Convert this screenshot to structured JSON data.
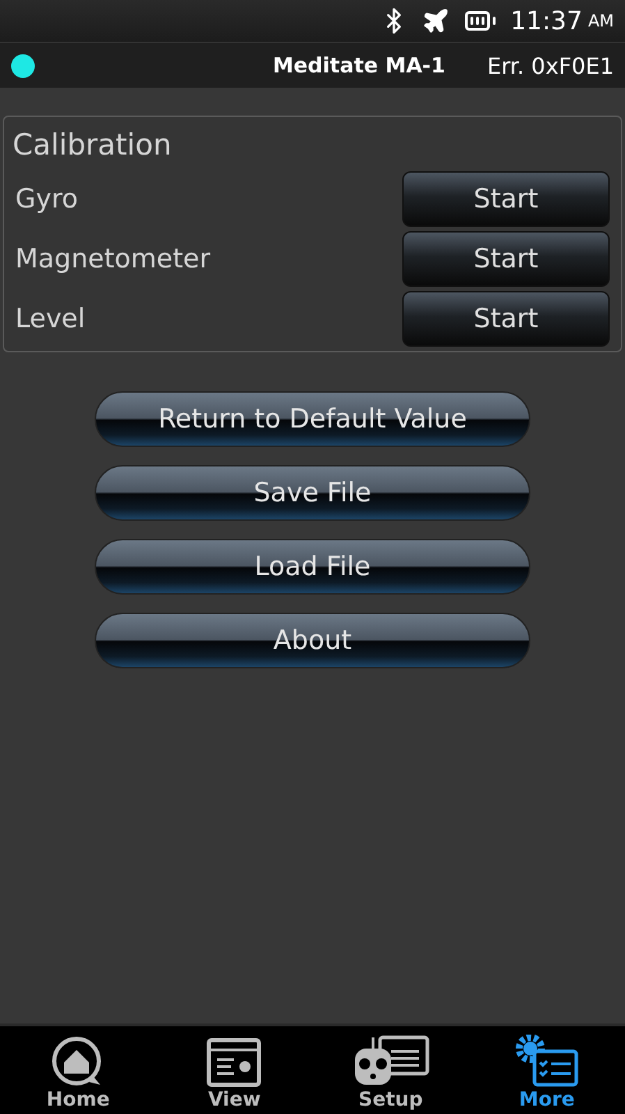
{
  "status_bar": {
    "time": "11:37",
    "ampm": "AM"
  },
  "header": {
    "status_dot": {
      "color": "#1ee8e4"
    },
    "title": "Meditate MA-1",
    "error": "Err. 0xF0E1"
  },
  "calibration": {
    "title": "Calibration",
    "rows": [
      {
        "label": "Gyro",
        "button": "Start"
      },
      {
        "label": "Magnetometer",
        "button": "Start"
      },
      {
        "label": "Level",
        "button": "Start"
      }
    ]
  },
  "actions": [
    "Return to Default Value",
    "Save File",
    "Load File",
    "About"
  ],
  "nav": [
    {
      "kind": "home",
      "label": "Home",
      "selected": false
    },
    {
      "kind": "view",
      "label": "View",
      "selected": false
    },
    {
      "kind": "setup",
      "label": "Setup",
      "selected": false
    },
    {
      "kind": "more",
      "label": "More",
      "selected": true
    }
  ]
}
